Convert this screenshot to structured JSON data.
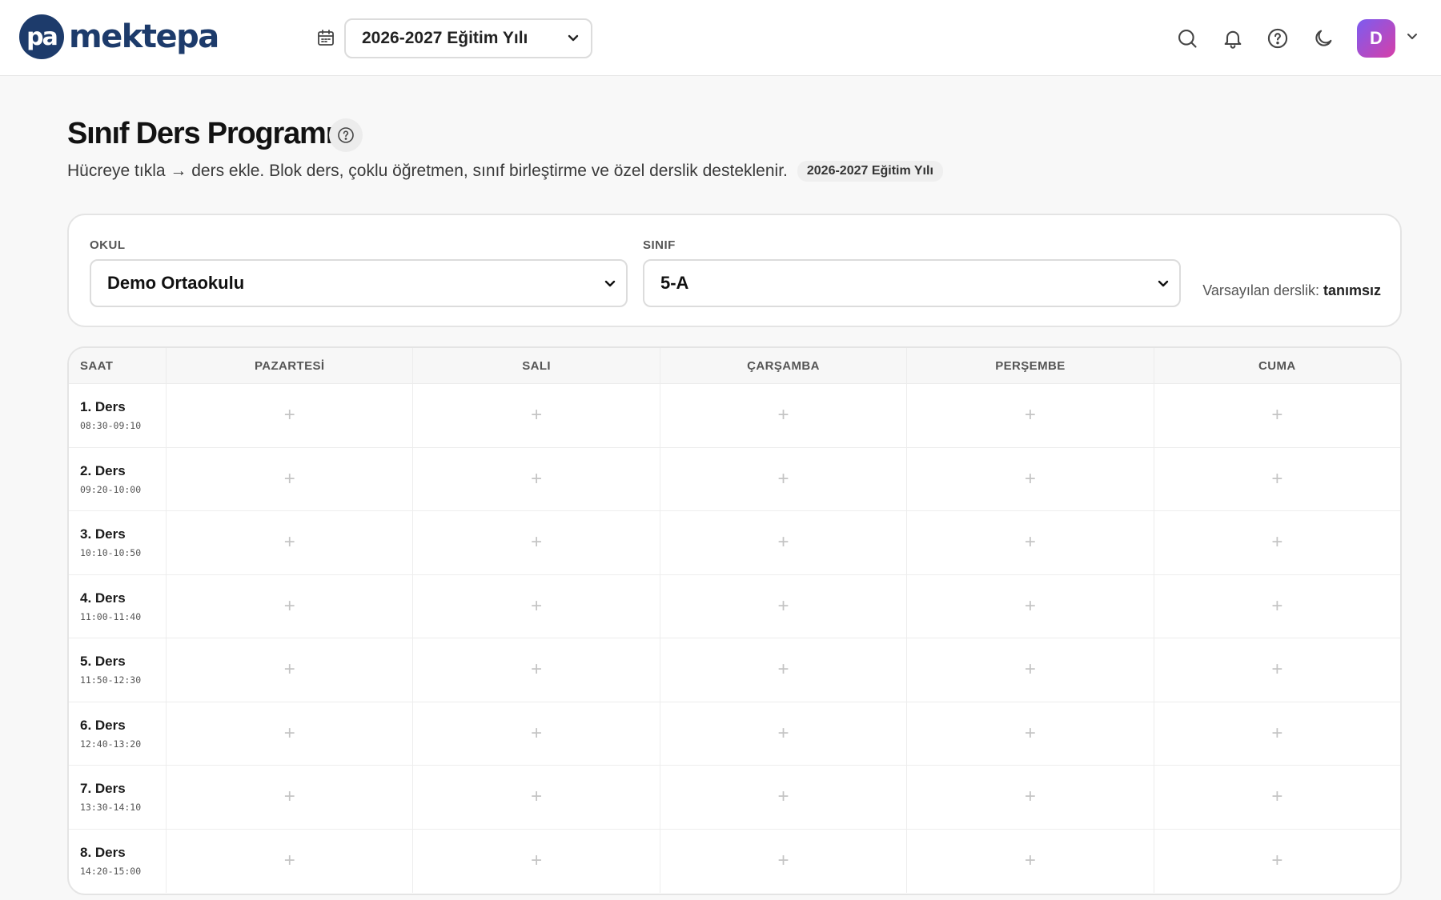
{
  "header": {
    "brand": "mektepa",
    "logo_mark": "pa",
    "academic_year": "2026-2027 Eğitim Yılı",
    "icons": [
      "search-icon",
      "bell-icon",
      "help-icon",
      "moon-icon"
    ],
    "avatar_initial": "D"
  },
  "page": {
    "title": "Sınıf Ders Programı",
    "subtitle": "Hücreye tıkla → ders ekle. Blok ders, çoklu öğretmen, sınıf birleştirme ve özel derslik desteklenir.",
    "year_badge": "2026-2027 Eğitim Yılı"
  },
  "filters": {
    "school_label": "OKUL",
    "school_value": "Demo Ortaokulu",
    "class_label": "SINIF",
    "class_value": "5-A",
    "default_room_label": "Varsayılan derslik:",
    "default_room_value": "tanımsız"
  },
  "timetable": {
    "time_header": "SAAT",
    "days": [
      "PAZARTESİ",
      "SALI",
      "ÇARŞAMBA",
      "PERŞEMBE",
      "CUMA"
    ],
    "empty_slot_symbol": "+",
    "periods": [
      {
        "name": "1. Ders",
        "time": "08:30-09:10"
      },
      {
        "name": "2. Ders",
        "time": "09:20-10:00"
      },
      {
        "name": "3. Ders",
        "time": "10:10-10:50"
      },
      {
        "name": "4. Ders",
        "time": "11:00-11:40"
      },
      {
        "name": "5. Ders",
        "time": "11:50-12:30"
      },
      {
        "name": "6. Ders",
        "time": "12:40-13:20"
      },
      {
        "name": "7. Ders",
        "time": "13:30-14:10"
      },
      {
        "name": "8. Ders",
        "time": "14:20-15:00"
      }
    ]
  },
  "colors": {
    "brand": "#1d3b6b",
    "avatar_gradient_start": "#7c5cf0",
    "avatar_gradient_end": "#d63fa8"
  }
}
